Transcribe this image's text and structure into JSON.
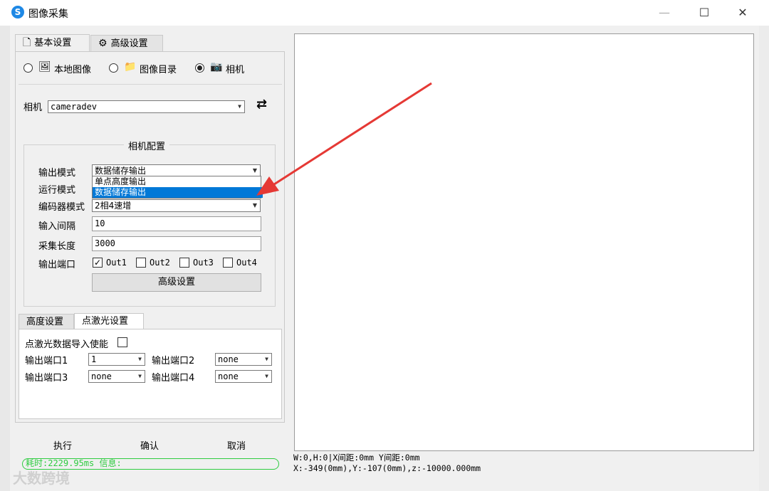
{
  "window": {
    "title": "图像采集",
    "app_icon": "S",
    "minimize_glyph": "—",
    "maximize_glyph": "☐",
    "close_glyph": "✕"
  },
  "left_tabs": [
    {
      "label": "基本设置",
      "icon": "document-icon",
      "glyph": "🗋",
      "active": true
    },
    {
      "label": "高级设置",
      "icon": "gears-icon",
      "glyph": "⚙",
      "active": false
    }
  ],
  "source": {
    "options": [
      {
        "label": "本地图像",
        "icon": "image-icon",
        "glyph": "🖼",
        "selected": false
      },
      {
        "label": "图像目录",
        "icon": "folder-icon",
        "glyph": "📁",
        "selected": false
      },
      {
        "label": "相机",
        "icon": "camera-icon",
        "glyph": "📷",
        "selected": true
      }
    ]
  },
  "camera": {
    "label": "相机",
    "value": "cameradev",
    "refresh_icon": "refresh-icon",
    "refresh_glyph": "⇄"
  },
  "camera_config": {
    "group_title": "相机配置",
    "output_mode_label": "输出模式",
    "output_mode_value": "数据储存输出",
    "output_mode_options": [
      "单点高度输出",
      "数据储存输出"
    ],
    "run_mode_label": "运行模式",
    "encoder_mode_label": "编码器模式",
    "encoder_mode_value": "2相4速增",
    "input_interval_label": "输入间隔",
    "input_interval_value": "10",
    "capture_length_label": "采集长度",
    "capture_length_value": "3000",
    "output_port_label": "输出端口",
    "ports": [
      {
        "label": "Out1",
        "checked": true
      },
      {
        "label": "Out2",
        "checked": false
      },
      {
        "label": "Out3",
        "checked": false
      },
      {
        "label": "Out4",
        "checked": false
      }
    ],
    "advanced_button": "高级设置"
  },
  "lower_tabs": [
    {
      "label": "高度设置",
      "active": false
    },
    {
      "label": "点激光设置",
      "active": true
    }
  ],
  "laser": {
    "import_enable_label": "点激光数据导入使能",
    "port1_label": "输出端口1",
    "port1_value": "1",
    "port2_label": "输出端口2",
    "port2_value": "none",
    "port3_label": "输出端口3",
    "port3_value": "none",
    "port4_label": "输出端口4",
    "port4_value": "none"
  },
  "actions": {
    "execute": "执行",
    "confirm": "确认",
    "cancel": "取消"
  },
  "status": {
    "text": "耗时:2229.95ms 信息:"
  },
  "canvas_status": {
    "line1": "W:0,H:0|X间距:0mm Y间距:0mm",
    "line2": "X:-349(0mm),Y:-107(0mm),z:-10000.000mm"
  },
  "watermark": {
    "text": "大数跨境"
  },
  "colors": {
    "accent": "#0078d7",
    "status_green": "#2ecc40",
    "arrow_red": "#e53935"
  }
}
